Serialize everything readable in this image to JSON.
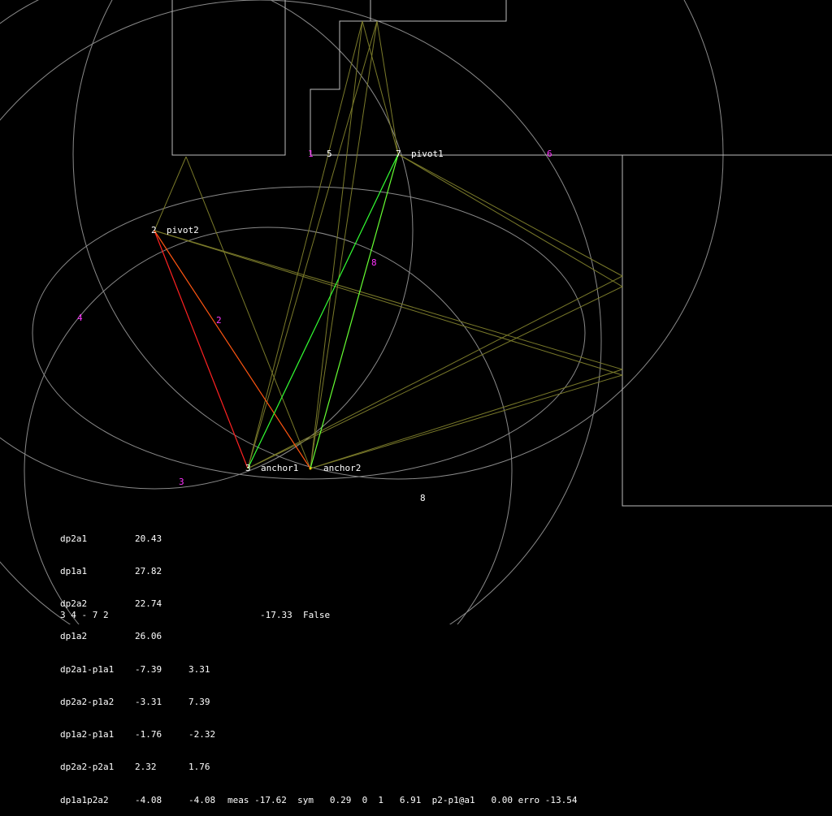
{
  "colors": {
    "background": "#000000",
    "circle": "#8a8a8a",
    "frame": "#bdbdbd",
    "olive": "#7a7a2a",
    "red": "#ff2222",
    "green": "#33ff33",
    "orange": "#ff8800",
    "magenta": "#ff33ff",
    "white": "#ffffff"
  },
  "points": {
    "pivot1": {
      "label": "pivot1",
      "marker": "7"
    },
    "pivot2": {
      "label": "pivot2",
      "marker": "2"
    },
    "anchor1": {
      "label": "anchor1",
      "marker": "3"
    },
    "anchor2": {
      "label": "anchor2"
    }
  },
  "region_labels": [
    {
      "text": "1",
      "color": "magenta"
    },
    {
      "text": "5",
      "color": "white"
    },
    {
      "text": "6",
      "color": "magenta"
    },
    {
      "text": "8",
      "color": "magenta"
    },
    {
      "text": "2",
      "color": "magenta"
    },
    {
      "text": "4",
      "color": "magenta"
    },
    {
      "text": "3",
      "color": "magenta"
    },
    {
      "text": "8",
      "color": "white"
    }
  ],
  "stats": {
    "rows": [
      {
        "name": "dp2a1",
        "v1": "20.43",
        "v2": ""
      },
      {
        "name": "dp1a1",
        "v1": "27.82",
        "v2": ""
      },
      {
        "name": "dp2a2",
        "v1": "22.74",
        "v2": ""
      },
      {
        "name": "dp1a2",
        "v1": "26.06",
        "v2": ""
      },
      {
        "name": "dp2a1-p1a1",
        "v1": "-7.39",
        "v2": "3.31"
      },
      {
        "name": "dp2a2-p1a2",
        "v1": "-3.31",
        "v2": "7.39"
      },
      {
        "name": "dp1a2-p1a1",
        "v1": "-1.76",
        "v2": "-2.32"
      },
      {
        "name": "dp2a2-p2a1",
        "v1": "2.32",
        "v2": "1.76"
      },
      {
        "name": "dp1a1p2a2",
        "v1": "-4.08",
        "v2": "-4.08"
      }
    ],
    "extra_line": "meas -17.62  sym   0.29  0  1   6.91  p2-p1@a1   0.00 erro -13.54",
    "footer_left": "3 4 - 7 2",
    "footer_right": "-17.33  False"
  }
}
